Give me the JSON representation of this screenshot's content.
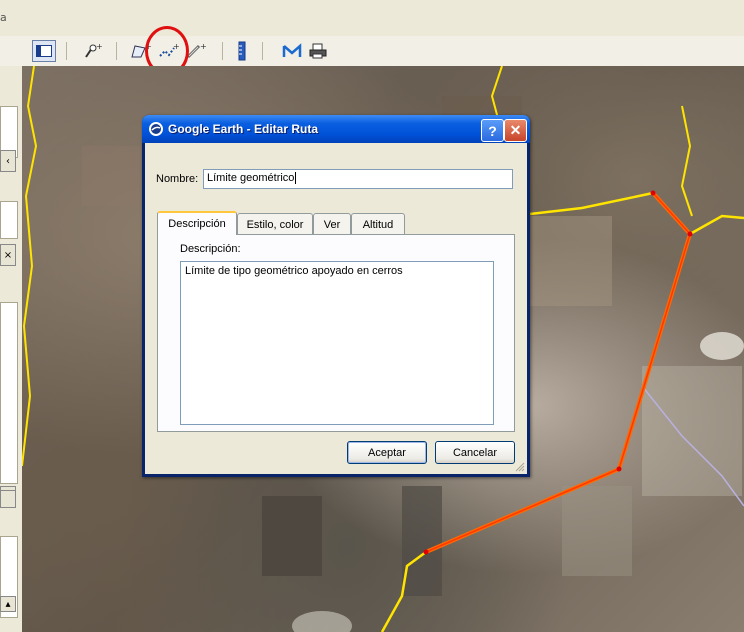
{
  "window": {
    "menubar_fragment": "a"
  },
  "toolbar": {
    "icons": [
      "sidebar-toggle-icon",
      "placemark-icon",
      "polygon-icon",
      "path-icon",
      "image-overlay-icon",
      "ruler-icon",
      "email-icon",
      "print-icon"
    ]
  },
  "dialog": {
    "title": "Google Earth - Editar Ruta",
    "help": "?",
    "close": "✕",
    "name_label": "Nombre:",
    "name_value": "Límite geométrico",
    "tabs": [
      {
        "label": "Descripción",
        "active": true
      },
      {
        "label": "Estilo, color",
        "active": false
      },
      {
        "label": "Ver",
        "active": false
      },
      {
        "label": "Altitud",
        "active": false
      }
    ],
    "description_label": "Descripción:",
    "description_value": "Límite de tipo geométrico apoyado en cerros",
    "ok_label": "Aceptar",
    "cancel_label": "Cancelar"
  },
  "colors": {
    "path_line": "#ff6a00",
    "border_line": "#ffe400",
    "annotation_circle": "#e01010",
    "titlebar": "#0051d8"
  }
}
